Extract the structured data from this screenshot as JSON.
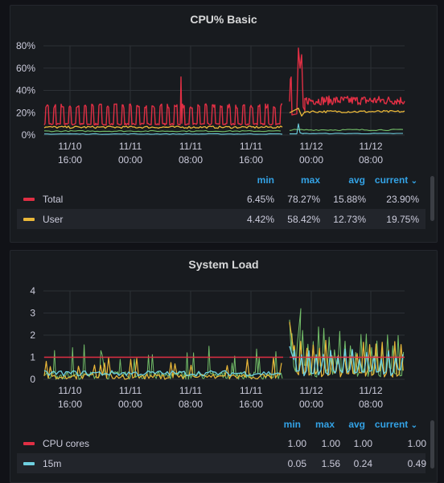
{
  "colors": {
    "red": "#e02f44",
    "yellow": "#eab839",
    "green": "#73bf69",
    "cyan": "#6ed0e0",
    "header_blue": "#33a2e5",
    "panel_bg": "#181b1f"
  },
  "x_ticks": [
    {
      "d": "11/10",
      "t": "16:00"
    },
    {
      "d": "11/11",
      "t": "00:00"
    },
    {
      "d": "11/11",
      "t": "08:00"
    },
    {
      "d": "11/11",
      "t": "16:00"
    },
    {
      "d": "11/12",
      "t": "00:00"
    },
    {
      "d": "11/12",
      "t": "08:00"
    }
  ],
  "legend_headers": {
    "min": "min",
    "max": "max",
    "avg": "avg",
    "current": "current"
  },
  "cpu_panel": {
    "title": "CPU% Basic",
    "y_ticks": [
      "0%",
      "20%",
      "40%",
      "60%",
      "80%"
    ],
    "legend": [
      {
        "name": "Total",
        "color": "#e02f44",
        "min": "6.45%",
        "max": "78.27%",
        "avg": "15.88%",
        "current": "23.90%"
      },
      {
        "name": "User",
        "color": "#eab839",
        "min": "4.42%",
        "max": "58.42%",
        "avg": "12.73%",
        "current": "19.75%"
      }
    ]
  },
  "load_panel": {
    "title": "System Load",
    "y_ticks": [
      "0",
      "1",
      "2",
      "3",
      "4"
    ],
    "legend": [
      {
        "name": "CPU cores",
        "color": "#e02f44",
        "min": "1.00",
        "max": "1.00",
        "avg": "1.00",
        "current": "1.00"
      },
      {
        "name": "15m",
        "color": "#6ed0e0",
        "min": "0.05",
        "max": "1.56",
        "avg": "0.24",
        "current": "0.49"
      }
    ]
  },
  "chart_data": [
    {
      "type": "line",
      "title": "CPU% Basic",
      "y_unit": "%",
      "ylim": [
        0,
        80
      ],
      "grid": true,
      "legend_placement": "bottom",
      "x_range": [
        "11/10 12:00",
        "11/12 14:00"
      ],
      "series": [
        {
          "name": "Total",
          "color": "#e02f44",
          "min": 6.45,
          "max": 78.27,
          "avg": 15.88,
          "current": 23.9
        },
        {
          "name": "User",
          "color": "#eab839",
          "min": 4.42,
          "max": 58.42,
          "avg": 12.73,
          "current": 19.75
        }
      ]
    },
    {
      "type": "line",
      "title": "System Load",
      "ylim": [
        0,
        4
      ],
      "grid": true,
      "legend_placement": "bottom",
      "x_range": [
        "11/10 12:00",
        "11/12 14:00"
      ],
      "series": [
        {
          "name": "CPU cores",
          "color": "#e02f44",
          "min": 1.0,
          "max": 1.0,
          "avg": 1.0,
          "current": 1.0
        },
        {
          "name": "15m",
          "color": "#6ed0e0",
          "min": 0.05,
          "max": 1.56,
          "avg": 0.24,
          "current": 0.49
        }
      ]
    }
  ]
}
